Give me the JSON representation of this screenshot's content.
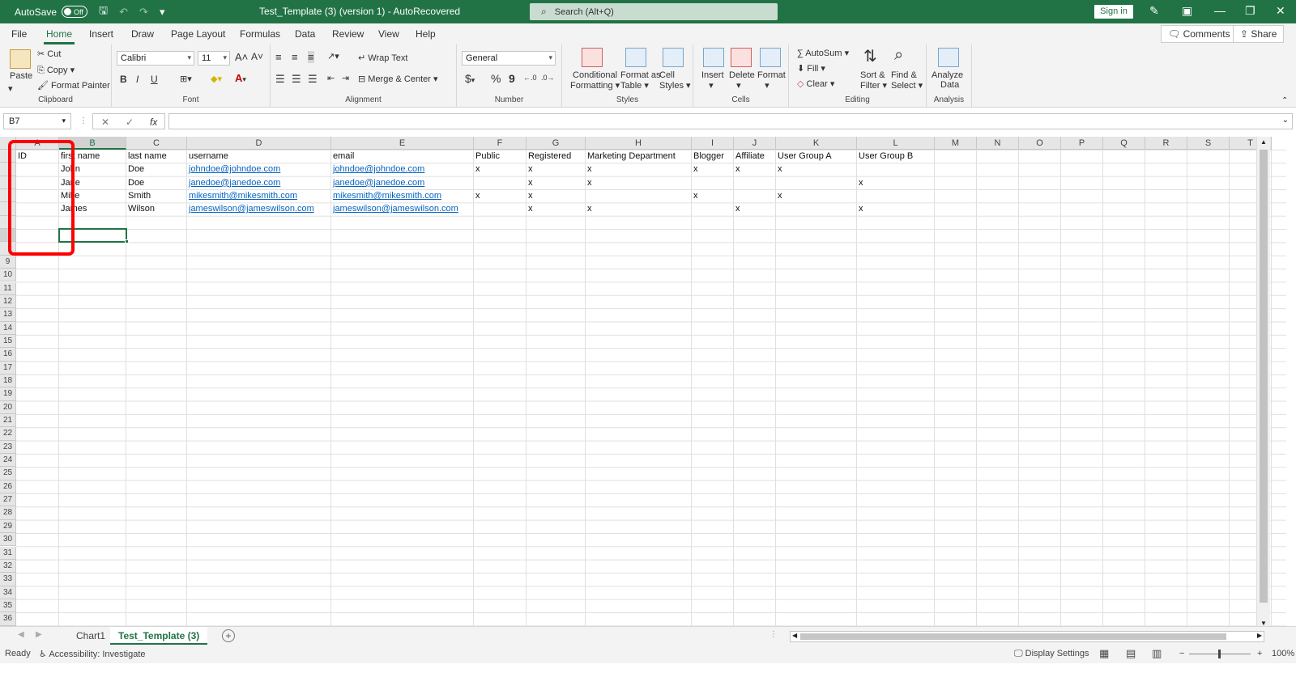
{
  "titlebar": {
    "autosave_label": "AutoSave",
    "autosave_state": "Off",
    "doc_title": "Test_Template (3) (version 1)  -  AutoRecovered",
    "search_placeholder": "Search (Alt+Q)",
    "signin_label": "Sign in"
  },
  "tabs": [
    "File",
    "Home",
    "Insert",
    "Draw",
    "Page Layout",
    "Formulas",
    "Data",
    "Review",
    "View",
    "Help"
  ],
  "tab_actions": {
    "comments": "Comments",
    "share": "Share"
  },
  "ribbon": {
    "clipboard": {
      "label": "Clipboard",
      "paste": "Paste",
      "cut": "Cut",
      "copy": "Copy",
      "format_painter": "Format Painter"
    },
    "font": {
      "label": "Font",
      "family": "Calibri",
      "size": "11",
      "bold": "B",
      "italic": "I",
      "underline": "U"
    },
    "alignment": {
      "label": "Alignment",
      "wrap_text": "Wrap Text",
      "merge_center": "Merge & Center"
    },
    "number": {
      "label": "Number",
      "format": "General",
      "currency": "$",
      "percent": "%",
      "comma": "9"
    },
    "styles": {
      "label": "Styles",
      "conditional": "Conditional",
      "conditional2": "Formatting",
      "format_as": "Format as",
      "format_as2": "Table",
      "cell": "Cell",
      "cell2": "Styles"
    },
    "cells": {
      "label": "Cells",
      "insert": "Insert",
      "delete": "Delete",
      "format": "Format"
    },
    "editing": {
      "label": "Editing",
      "autosum": "AutoSum",
      "fill": "Fill",
      "clear": "Clear",
      "sort": "Sort &",
      "sort2": "Filter",
      "find": "Find &",
      "find2": "Select"
    },
    "analysis": {
      "label": "Analysis",
      "analyze": "Analyze",
      "analyze2": "Data"
    }
  },
  "formulabar": {
    "namebox": "B7",
    "fx": "fx",
    "cancel": "✕",
    "enter": "✓",
    "formula": ""
  },
  "columns": [
    "A",
    "B",
    "C",
    "D",
    "E",
    "F",
    "G",
    "H",
    "I",
    "J",
    "K",
    "L",
    "M",
    "N",
    "O",
    "P",
    "Q",
    "R",
    "S",
    "T"
  ],
  "rows": [
    "9",
    "10",
    "11",
    "12",
    "13",
    "14",
    "15",
    "16",
    "17",
    "18",
    "19",
    "20",
    "21",
    "22",
    "23",
    "24",
    "25",
    "26",
    "27",
    "28",
    "29",
    "30",
    "31",
    "32",
    "33",
    "34",
    "35",
    "36"
  ],
  "sheet": {
    "header": [
      "ID",
      "first name",
      "last name",
      "username",
      "email",
      "Public",
      "Registered",
      "Marketing Department",
      "Blogger",
      "Affiliate",
      "User Group A",
      "User Group B"
    ],
    "data": [
      [
        "",
        "John",
        "Doe",
        "johndoe@johndoe.com",
        "johndoe@johndoe.com",
        "x",
        "x",
        "x",
        "x",
        "x",
        "x",
        ""
      ],
      [
        "",
        "Jane",
        "Doe",
        "janedoe@janedoe.com",
        "janedoe@janedoe.com",
        "",
        "x",
        "x",
        "",
        "",
        "",
        "x"
      ],
      [
        "",
        "Mike",
        "Smith",
        "mikesmith@mikesmith.com",
        "mikesmith@mikesmith.com",
        "x",
        "x",
        "",
        "x",
        "",
        "x",
        ""
      ],
      [
        "",
        "James",
        "Wilson",
        "jameswilson@jameswilson.com",
        "jameswilson@jameswilson.com",
        "",
        "x",
        "x",
        "",
        "x",
        "",
        "x"
      ]
    ]
  },
  "sheet_tabs": [
    "Chart1",
    "Test_Template (3)"
  ],
  "add_sheet": "+",
  "statusbar": {
    "ready": "Ready",
    "accessibility": "Accessibility: Investigate",
    "display_settings": "Display Settings",
    "zoom_minus": "−",
    "zoom_plus": "+",
    "zoom": "100%"
  }
}
